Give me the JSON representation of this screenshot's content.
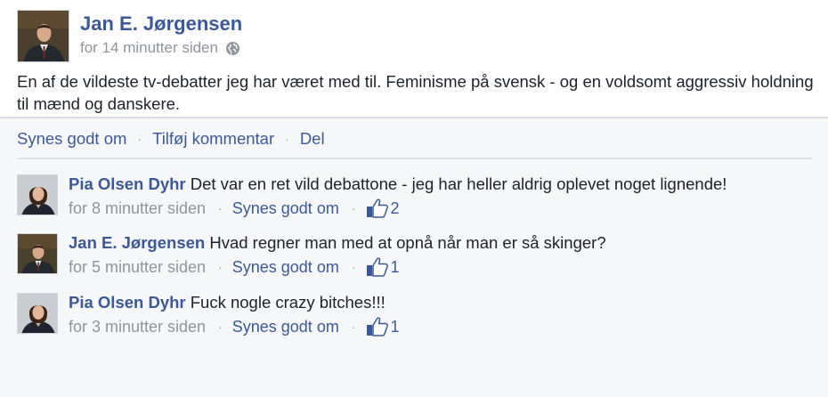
{
  "post": {
    "author": "Jan E. Jørgensen",
    "timestamp": "for 14 minutter siden",
    "privacy_icon": "globe-icon",
    "text": "En af de vildeste tv-debatter jeg har været med til. Feminisme på svensk - og en voldsomt aggressiv holdning til mænd og danskere."
  },
  "actions": {
    "like": "Synes godt om",
    "comment": "Tilføj kommentar",
    "share": "Del",
    "separator": "·"
  },
  "comments": [
    {
      "author": "Pia Olsen Dyhr",
      "text": "Det var en ret vild debattone - jeg har heller aldrig oplevet noget lignende!",
      "timestamp": "for 8 minutter siden",
      "like_label": "Synes godt om",
      "likes": "2"
    },
    {
      "author": "Jan E. Jørgensen",
      "text": "Hvad regner man med at opnå når man er så skinger?",
      "timestamp": "for 5 minutter siden",
      "like_label": "Synes godt om",
      "likes": "1"
    },
    {
      "author": "Pia Olsen Dyhr",
      "text": "Fuck nogle crazy bitches!!!",
      "timestamp": "for 3 minutter siden",
      "like_label": "Synes godt om",
      "likes": "1"
    }
  ],
  "colors": {
    "link_blue": "#3b5998",
    "meta_gray": "#90949c",
    "text": "#1d2129",
    "comment_bg": "#f6f7f9"
  }
}
